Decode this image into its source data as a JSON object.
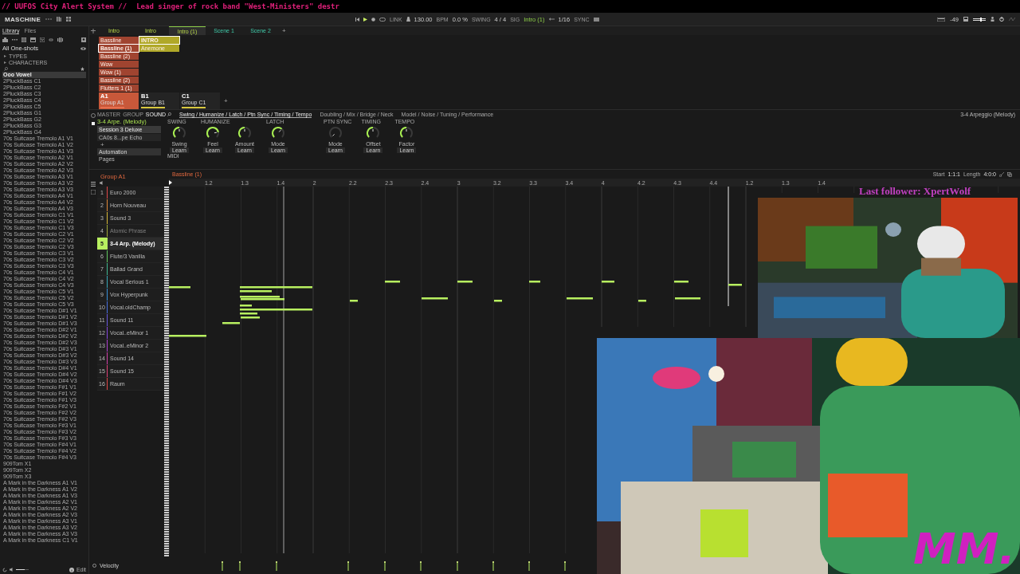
{
  "stream_banner": {
    "title": "// UUFOS City Alert System //",
    "ticker": "Lead singer of rock band \"West-Ministers\" destr"
  },
  "header": {
    "logo": "MASCHINE",
    "link": "LINK",
    "transport": [
      {
        "value": "130.00",
        "unit": "BPM"
      },
      {
        "value": "0.0 %",
        "unit": "SWING"
      },
      {
        "value": "4 / 4",
        "unit": "SIG"
      }
    ],
    "scene": "Intro (1)",
    "grid": "1/16",
    "sync": "SYNC",
    "volume": "-49"
  },
  "library": {
    "tabs": [
      {
        "label": "Library",
        "selected": true
      },
      {
        "label": "Files",
        "selected": false
      }
    ],
    "category": "All One-shots",
    "filters": [
      "TYPES",
      "CHARACTERS"
    ],
    "items": [
      {
        "name": "Ooo Vowel",
        "selected": true
      },
      {
        "name": "2PluckBass C1",
        "selected": false
      },
      {
        "name": "2PluckBass C2",
        "selected": false
      },
      {
        "name": "2PluckBass C3",
        "selected": false
      },
      {
        "name": "2PluckBass C4",
        "selected": false
      },
      {
        "name": "2PluckBass C5",
        "selected": false
      },
      {
        "name": "2PluckBass G1",
        "selected": false
      },
      {
        "name": "2PluckBass G2",
        "selected": false
      },
      {
        "name": "2PluckBass G3",
        "selected": false
      },
      {
        "name": "2PluckBass G4",
        "selected": false
      },
      {
        "name": "70s Suitcase Tremolo A1 V1",
        "selected": false
      },
      {
        "name": "70s Suitcase Tremolo A1 V2",
        "selected": false
      },
      {
        "name": "70s Suitcase Tremolo A1 V3",
        "selected": false
      },
      {
        "name": "70s Suitcase Tremolo A2 V1",
        "selected": false
      },
      {
        "name": "70s Suitcase Tremolo A2 V2",
        "selected": false
      },
      {
        "name": "70s Suitcase Tremolo A2 V3",
        "selected": false
      },
      {
        "name": "70s Suitcase Tremolo A3 V1",
        "selected": false
      },
      {
        "name": "70s Suitcase Tremolo A3 V2",
        "selected": false
      },
      {
        "name": "70s Suitcase Tremolo A3 V3",
        "selected": false
      },
      {
        "name": "70s Suitcase Tremolo A4 V1",
        "selected": false
      },
      {
        "name": "70s Suitcase Tremolo A4 V2",
        "selected": false
      },
      {
        "name": "70s Suitcase Tremolo A4 V3",
        "selected": false
      },
      {
        "name": "70s Suitcase Tremolo C1 V1",
        "selected": false
      },
      {
        "name": "70s Suitcase Tremolo C1 V2",
        "selected": false
      },
      {
        "name": "70s Suitcase Tremolo C1 V3",
        "selected": false
      },
      {
        "name": "70s Suitcase Tremolo C2 V1",
        "selected": false
      },
      {
        "name": "70s Suitcase Tremolo C2 V2",
        "selected": false
      },
      {
        "name": "70s Suitcase Tremolo C2 V3",
        "selected": false
      },
      {
        "name": "70s Suitcase Tremolo C3 V1",
        "selected": false
      },
      {
        "name": "70s Suitcase Tremolo C3 V2",
        "selected": false
      },
      {
        "name": "70s Suitcase Tremolo C3 V3",
        "selected": false
      },
      {
        "name": "70s Suitcase Tremolo C4 V1",
        "selected": false
      },
      {
        "name": "70s Suitcase Tremolo C4 V2",
        "selected": false
      },
      {
        "name": "70s Suitcase Tremolo C4 V3",
        "selected": false
      },
      {
        "name": "70s Suitcase Tremolo C5 V1",
        "selected": false
      },
      {
        "name": "70s Suitcase Tremolo C5 V2",
        "selected": false
      },
      {
        "name": "70s Suitcase Tremolo C5 V3",
        "selected": false
      },
      {
        "name": "70s Suitcase Tremolo D#1 V1",
        "selected": false
      },
      {
        "name": "70s Suitcase Tremolo D#1 V2",
        "selected": false
      },
      {
        "name": "70s Suitcase Tremolo D#1 V3",
        "selected": false
      },
      {
        "name": "70s Suitcase Tremolo D#2 V1",
        "selected": false
      },
      {
        "name": "70s Suitcase Tremolo D#2 V2",
        "selected": false
      },
      {
        "name": "70s Suitcase Tremolo D#2 V3",
        "selected": false
      },
      {
        "name": "70s Suitcase Tremolo D#3 V1",
        "selected": false
      },
      {
        "name": "70s Suitcase Tremolo D#3 V2",
        "selected": false
      },
      {
        "name": "70s Suitcase Tremolo D#3 V3",
        "selected": false
      },
      {
        "name": "70s Suitcase Tremolo D#4 V1",
        "selected": false
      },
      {
        "name": "70s Suitcase Tremolo D#4 V2",
        "selected": false
      },
      {
        "name": "70s Suitcase Tremolo D#4 V3",
        "selected": false
      },
      {
        "name": "70s Suitcase Tremolo F#1 V1",
        "selected": false
      },
      {
        "name": "70s Suitcase Tremolo F#1 V2",
        "selected": false
      },
      {
        "name": "70s Suitcase Tremolo F#1 V3",
        "selected": false
      },
      {
        "name": "70s Suitcase Tremolo F#2 V1",
        "selected": false
      },
      {
        "name": "70s Suitcase Tremolo F#2 V2",
        "selected": false
      },
      {
        "name": "70s Suitcase Tremolo F#2 V3",
        "selected": false
      },
      {
        "name": "70s Suitcase Tremolo F#3 V1",
        "selected": false
      },
      {
        "name": "70s Suitcase Tremolo F#3 V2",
        "selected": false
      },
      {
        "name": "70s Suitcase Tremolo F#3 V3",
        "selected": false
      },
      {
        "name": "70s Suitcase Tremolo F#4 V1",
        "selected": false
      },
      {
        "name": "70s Suitcase Tremolo F#4 V2",
        "selected": false
      },
      {
        "name": "70s Suitcase Tremolo F#4 V3",
        "selected": false
      },
      {
        "name": "909Tom X1",
        "selected": false
      },
      {
        "name": "909Tom X2",
        "selected": false
      },
      {
        "name": "909Tom X3",
        "selected": false
      },
      {
        "name": "A Mark in the Darkness A1 V1",
        "selected": false
      },
      {
        "name": "A Mark in the Darkness A1 V2",
        "selected": false
      },
      {
        "name": "A Mark in the Darkness A1 V3",
        "selected": false
      },
      {
        "name": "A Mark in the Darkness A2 V1",
        "selected": false
      },
      {
        "name": "A Mark in the Darkness A2 V2",
        "selected": false
      },
      {
        "name": "A Mark in the Darkness A2 V3",
        "selected": false
      },
      {
        "name": "A Mark in the Darkness A3 V1",
        "selected": false
      },
      {
        "name": "A Mark in the Darkness A3 V2",
        "selected": false
      },
      {
        "name": "A Mark in the Darkness A3 V3",
        "selected": false
      },
      {
        "name": "A Mark in the Darkness C1 V1",
        "selected": false
      }
    ],
    "volume": {
      "level": 0.7
    },
    "footer": "Edit"
  },
  "arranger": {
    "scenes": [
      {
        "label": "Intro",
        "selected": false
      },
      {
        "label": "Intro",
        "selected": false
      },
      {
        "label": "Intro (1)",
        "selected": true
      },
      {
        "label": "Scene 1",
        "selected": false
      },
      {
        "label": "Scene 2",
        "selected": false
      }
    ],
    "add": "+",
    "columns": [
      {
        "color": "#a04430",
        "cells": [
          {
            "label": "Bassline",
            "selected": false
          },
          {
            "label": "Bassline (1)",
            "selected": true
          },
          {
            "label": "Bassline (2)",
            "selected": false
          },
          {
            "label": "Wow",
            "selected": false
          },
          {
            "label": "Wow (1)",
            "selected": false
          },
          {
            "label": "Bassline (2)",
            "selected": false
          },
          {
            "label": "Flutters 1 (1)",
            "selected": false
          }
        ]
      },
      {
        "color": "#b0a828",
        "cells": [
          {
            "label": "INTRO",
            "selected": true
          },
          {
            "label": "Anemone",
            "selected": false
          }
        ]
      }
    ],
    "groups": [
      {
        "id": "A1",
        "name": "Group A1",
        "selected": true,
        "color": "#e8704f"
      },
      {
        "id": "B1",
        "name": "Group B1",
        "selected": false,
        "color": "#d8c840"
      },
      {
        "id": "C1",
        "name": "Group C1",
        "selected": false,
        "color": "#d8c840"
      }
    ],
    "add_group": "+"
  },
  "plugin": {
    "tabs": [
      {
        "label": "MASTER",
        "selected": false
      },
      {
        "label": "GROUP",
        "selected": false
      },
      {
        "label": "SOUND",
        "selected": true
      }
    ],
    "sound": "3-4 Arpe. (Melody)",
    "slots": [
      "Session 3 Deluxe",
      "CA0s 8...pe Echo"
    ],
    "add": "+",
    "menu": [
      {
        "label": "Automation",
        "selected": true
      },
      {
        "label": "Pages",
        "selected": false
      }
    ],
    "pages": [
      {
        "label": "Swing / Humanize / Latch / Ptn Sync / Timing / Tempo",
        "selected": true
      },
      {
        "label": "Doubling / Mix / Bridge / Neck",
        "selected": false
      },
      {
        "label": "Model / Noise / Tuning / Performance",
        "selected": false
      }
    ],
    "sections": [
      {
        "title": "SWING",
        "knobs": [
          {
            "label": "Swing",
            "button": "Learn"
          }
        ]
      },
      {
        "title": "HUMANIZE",
        "knobs": [
          {
            "label": "Feel",
            "button": "Learn"
          },
          {
            "label": "Amount",
            "button": "Learn"
          }
        ]
      },
      {
        "title": "LATCH",
        "knobs": [
          {
            "label": "Mode",
            "button": "Learn"
          }
        ]
      },
      {
        "title": "PTN SYNC",
        "knobs": [
          {
            "label": "Mode",
            "button": "Learn"
          }
        ]
      },
      {
        "title": "TIMING",
        "knobs": [
          {
            "label": "Offset",
            "button": "Learn"
          }
        ]
      },
      {
        "title": "TEMPO",
        "knobs": [
          {
            "label": "Factor",
            "button": "Learn"
          }
        ]
      }
    ],
    "midi": "MIDI",
    "preset": "3-4 Arpeggio (Melody)"
  },
  "piano_roll": {
    "group": "Group A1",
    "pattern": "Bassline (1)",
    "start_label": "Start",
    "start": "1:1:1",
    "length_label": "Length",
    "length": "4:0:0",
    "ruler": [
      "1.2",
      "1.3",
      "1.4",
      "2",
      "2.2",
      "2.3",
      "2.4",
      "3",
      "3.2",
      "3.3",
      "3.4",
      "4",
      "4.2",
      "4.3",
      "4.4",
      "1.2",
      "1.3",
      "1.4"
    ],
    "sounds": [
      {
        "number": "1",
        "name": "Euro 2000",
        "color": "#e04848",
        "selected": false,
        "muted": false
      },
      {
        "number": "2",
        "name": "Horn Nouveau",
        "color": "#e08838",
        "selected": false,
        "muted": false
      },
      {
        "number": "3",
        "name": "Sound 3",
        "color": "#d8b838",
        "selected": false,
        "muted": false
      },
      {
        "number": "4",
        "name": "Atomic Phrase",
        "color": "#a0a838",
        "selected": false,
        "muted": true
      },
      {
        "number": "5",
        "name": "3-4 Arp. (Melody)",
        "color": "#b8f060",
        "selected": true,
        "muted": false
      },
      {
        "number": "6",
        "name": "Flute/3 Vanilla",
        "color": "#60c860",
        "selected": false,
        "muted": false
      },
      {
        "number": "7",
        "name": "Ballad Grand",
        "color": "#40b890",
        "selected": false,
        "muted": false
      },
      {
        "number": "8",
        "name": "Vocal Serious 1",
        "color": "#38a8b8",
        "selected": false,
        "muted": false
      },
      {
        "number": "9",
        "name": "Vox Hyperpunk",
        "color": "#3890d8",
        "selected": false,
        "muted": false
      },
      {
        "number": "10",
        "name": "Vocal.oldChamp",
        "color": "#4870e0",
        "selected": false,
        "muted": false
      },
      {
        "number": "11",
        "name": "Sound 11",
        "color": "#6858e0",
        "selected": false,
        "muted": false
      },
      {
        "number": "12",
        "name": "Vocal..eMinor 1",
        "color": "#8848e0",
        "selected": false,
        "muted": false
      },
      {
        "number": "13",
        "name": "Vocal..eMinor 2",
        "color": "#b040d0",
        "selected": false,
        "muted": false
      },
      {
        "number": "14",
        "name": "Sound 14",
        "color": "#d040a8",
        "selected": false,
        "muted": false
      },
      {
        "number": "15",
        "name": "Sound 15",
        "color": "#e04078",
        "selected": false,
        "muted": false
      },
      {
        "number": "16",
        "name": "Raum",
        "color": "#e04848",
        "selected": false,
        "muted": false
      }
    ]
  },
  "velocity_lane": {
    "label": "Velocity"
  },
  "overlay": {
    "last_follower": "Last follower: XpertWolf",
    "logo": "MM."
  }
}
